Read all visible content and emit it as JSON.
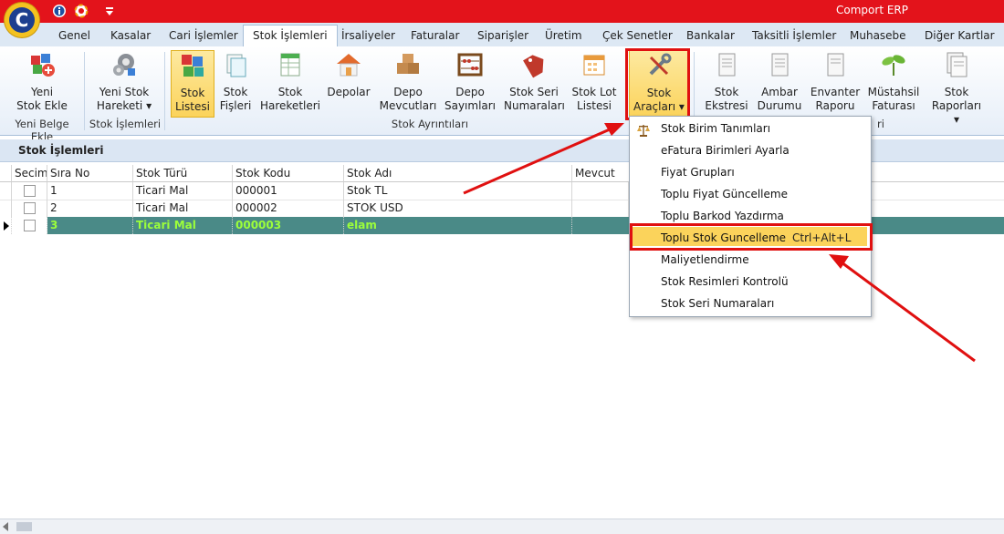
{
  "app": {
    "title": "Comport ERP",
    "logo_letter": "C"
  },
  "tabs": [
    "Genel",
    "Kasalar",
    "Cari İşlemler",
    "Stok İşlemleri",
    "İrsaliyeler",
    "Faturalar",
    "Siparişler",
    "Üretim",
    "Çek Senetler",
    "Bankalar",
    "Taksitli İşlemler",
    "Muhasebe",
    "Diğer Kartlar"
  ],
  "active_tab": "Stok İşlemleri",
  "ribbon": {
    "yeni_stok_ekle": [
      "Yeni",
      "Stok Ekle"
    ],
    "yeni_stok_hareketi": [
      "Yeni Stok",
      "Hareketi ▾"
    ],
    "stok_listesi": [
      "Stok",
      "Listesi"
    ],
    "stok_fisleri": [
      "Stok",
      "Fişleri"
    ],
    "stok_hareketleri": [
      "Stok",
      "Hareketleri"
    ],
    "depolar": [
      "Depolar"
    ],
    "depo_mevcutlari": [
      "Depo",
      "Mevcutları"
    ],
    "depo_sayimlari": [
      "Depo",
      "Sayımları"
    ],
    "stok_seri_numaralari": [
      "Stok Seri",
      "Numaraları"
    ],
    "stok_lot_listesi": [
      "Stok Lot",
      "Listesi"
    ],
    "stok_araclari": [
      "Stok",
      "Araçları ▾"
    ],
    "stok_ekstresi": [
      "Stok",
      "Ekstresi"
    ],
    "ambar_durumu": [
      "Ambar",
      "Durumu"
    ],
    "envanter_raporu": [
      "Envanter",
      "Raporu"
    ],
    "mustahsil_faturasi": [
      "Müstahsil",
      "Faturası"
    ],
    "stok_raporlari": [
      "Stok",
      "Raporları ▾"
    ],
    "groups": {
      "yeni_belge_ekle": "Yeni Belge Ekle",
      "stok_islemleri": "Stok İşlemleri",
      "stok_ayrintilari": "Stok Ayrıntıları",
      "partial": "ri"
    }
  },
  "section_title": "Stok İşlemleri",
  "grid": {
    "headers": [
      "Secim",
      "Sıra No",
      "Stok Türü",
      "Stok Kodu",
      "Stok Adı",
      "Mevcut"
    ],
    "rows": [
      {
        "sira": "1",
        "tur": "Ticari Mal",
        "kod": "000001",
        "ad": "Stok TL"
      },
      {
        "sira": "2",
        "tur": "Ticari Mal",
        "kod": "000002",
        "ad": "STOK USD"
      },
      {
        "sira": "3",
        "tur": "Ticari Mal",
        "kod": "000003",
        "ad": "elam"
      }
    ]
  },
  "menu": {
    "items": [
      "Stok Birim Tanımları",
      "eFatura Birimleri Ayarla",
      "Fiyat Grupları",
      "Toplu Fiyat Güncelleme",
      "Toplu Barkod Yazdırma",
      "Toplu Stok Guncelleme",
      "Maliyetlendirme",
      "Stok Resimleri Kontrolü",
      "Stok Seri Numaraları"
    ],
    "shortcut": "Ctrl+Alt+L"
  },
  "colors": {
    "titlebar": "#e3131b",
    "selected_row": "#4a8a87",
    "selected_text": "#9cff3a",
    "menu_highlight": "#fbd35b",
    "annotation": "#e01010"
  }
}
